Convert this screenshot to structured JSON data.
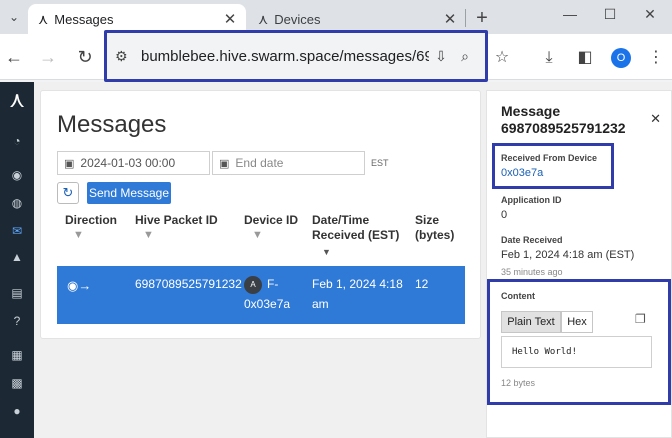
{
  "browser": {
    "tabs": [
      {
        "title": "Messages",
        "active": true,
        "icon": "swarm-icon"
      },
      {
        "title": "Devices",
        "active": false,
        "icon": "swarm-icon"
      }
    ],
    "url": "bumblebee.hive.swarm.space/messages/6987...",
    "profile_initial": "O"
  },
  "sidebar": {
    "items": [
      "dashboard-icon",
      "signal-icon",
      "globe-icon",
      "messages-icon",
      "bell-icon",
      "devices-icon",
      "help-icon",
      "document-icon",
      "grid-icon",
      "user-icon"
    ]
  },
  "page": {
    "title": "Messages",
    "filters": {
      "start_date": "2024-01-03 00:00",
      "end_date_placeholder": "End date",
      "timezone": "EST"
    },
    "send_button": "Send Message",
    "columns": {
      "direction": "Direction",
      "packet_id": "Hive Packet ID",
      "device_id": "Device ID",
      "datetime_1": "Date/Time",
      "datetime_2": "Received (EST)",
      "size_1": "Size",
      "size_2": "(bytes)"
    },
    "rows": [
      {
        "packet_id": "6987089525791232",
        "device_id_1": "F-",
        "device_id_2": "0x03e7a",
        "datetime_1": "Feb 1, 2024 4:18",
        "datetime_2": "am",
        "size": "12"
      }
    ]
  },
  "panel": {
    "title_1": "Message",
    "title_2": "6987089525791232",
    "received_from_label": "Received From Device",
    "received_from_value": "0x03e7a",
    "application_id_label": "Application ID",
    "application_id_value": "0",
    "date_received_label": "Date Received",
    "date_received_value": "Feb 1, 2024 4:18 am (EST)",
    "date_received_relative": "35 minutes ago",
    "content_label": "Content",
    "plain_text_tab": "Plain Text",
    "hex_tab": "Hex",
    "content_text": "Hello World!",
    "content_size": "12 bytes"
  },
  "colors": {
    "accent": "#2f7ad6",
    "highlight_box": "#2f3caa",
    "sidebar_bg": "#1c2833"
  }
}
